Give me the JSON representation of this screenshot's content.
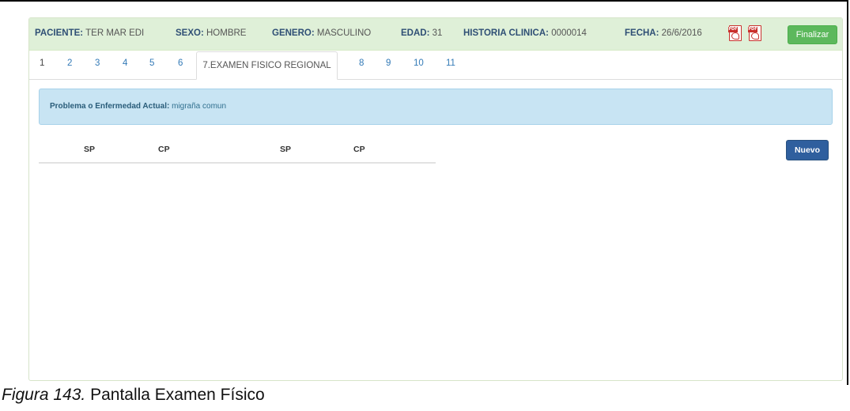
{
  "header": {
    "paciente_label": "PACIENTE:",
    "paciente_value": "TER MAR EDI",
    "sexo_label": "SEXO:",
    "sexo_value": "HOMBRE",
    "genero_label": "GENERO:",
    "genero_value": "MASCULINO",
    "edad_label": "EDAD:",
    "edad_value": "31",
    "historia_label": "HISTORIA CLINICA:",
    "historia_value": "0000014",
    "fecha_label": "FECHA:",
    "fecha_value": "26/6/2016",
    "pdf_tag": "PDF",
    "finalizar_label": "Finalizar"
  },
  "tabs": [
    "1",
    "2",
    "3",
    "4",
    "5",
    "6",
    "7.EXAMEN FISICO REGIONAL",
    "8",
    "9",
    "10",
    "11"
  ],
  "alert": {
    "label": "Problema o Enfermedad Actual:",
    "value": "migraña comun"
  },
  "table": {
    "headers": [
      "SP",
      "CP",
      "SP",
      "CP"
    ]
  },
  "nuevo_label": "Nuevo",
  "caption": {
    "figure": "Figura 143.",
    "text": "Pantalla Examen Físico"
  },
  "colors": {
    "header_bg": "#dff0d8",
    "finalizar": "#5cb85c",
    "alert_bg": "#c8e4f3",
    "nuevo": "#2f5f9e",
    "link": "#337ab7"
  },
  "icons": [
    "pdf-icon",
    "pdf-icon"
  ]
}
